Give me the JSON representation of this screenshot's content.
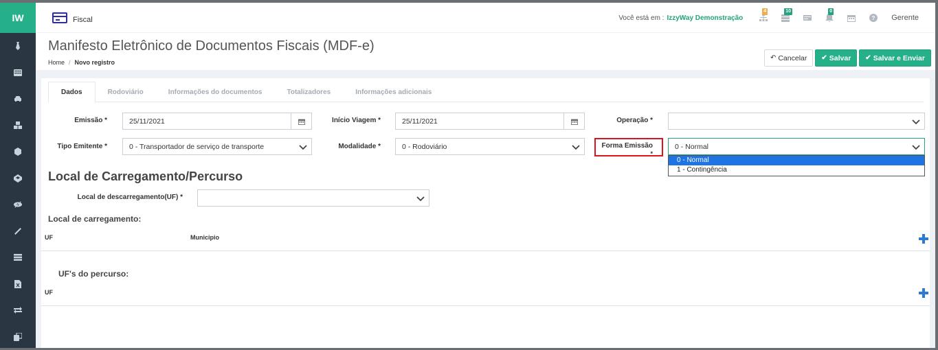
{
  "app": {
    "logo": "IW",
    "module": "Fiscal",
    "you_are_at": "Você está em :",
    "company": "IzzyWay Demonstração",
    "user": "Gerente",
    "badges": {
      "sitemap": "4",
      "grid": "10",
      "bell": "0"
    }
  },
  "sidebar": {
    "icons": [
      "tie-icon",
      "list-icon",
      "car-icon",
      "cubes-icon",
      "cube-icon",
      "codepen-icon",
      "eye-slash-icon",
      "magic-icon",
      "table-icon",
      "excel-icon",
      "exchange-icon",
      "clone-icon"
    ]
  },
  "page": {
    "title": "Manifesto Eletrônico de Documentos Fiscais (MDF-e)",
    "breadcrumb_home": "Home",
    "breadcrumb_sep": "/",
    "breadcrumb_current": "Novo registro",
    "actions": {
      "cancel": "Cancelar",
      "save": "Salvar",
      "save_send": "Salvar e Enviar"
    }
  },
  "tabs": [
    "Dados",
    "Rodoviário",
    "Informações do documentos",
    "Totalizadores",
    "Informações adicionais"
  ],
  "form": {
    "emissao_label": "Emissão *",
    "emissao_value": "25/11/2021",
    "inicio_label": "Início Viagem *",
    "inicio_value": "25/11/2021",
    "operacao_label": "Operação *",
    "operacao_value": "",
    "tipo_label": "Tipo Emitente *",
    "tipo_value": "0 - Transportador de serviço de transporte",
    "modalidade_label": "Modalidade *",
    "modalidade_value": "0 - Rodoviário",
    "forma_label": "Forma Emissão",
    "forma_required": "*",
    "forma_value": "0 - Normal",
    "forma_options": [
      "0 - Normal",
      "1 - Contingência"
    ]
  },
  "local": {
    "section_title": "Local de Carregamento/Percurso",
    "descarregamento_label": "Local de descarregamento(UF) *",
    "descarregamento_value": "",
    "carregamento_title": "Local de carregamento:",
    "col_uf": "UF",
    "col_municipio": "Municipio",
    "percurso_title": "UF's do percurso:",
    "percurso_col_uf": "UF"
  }
}
